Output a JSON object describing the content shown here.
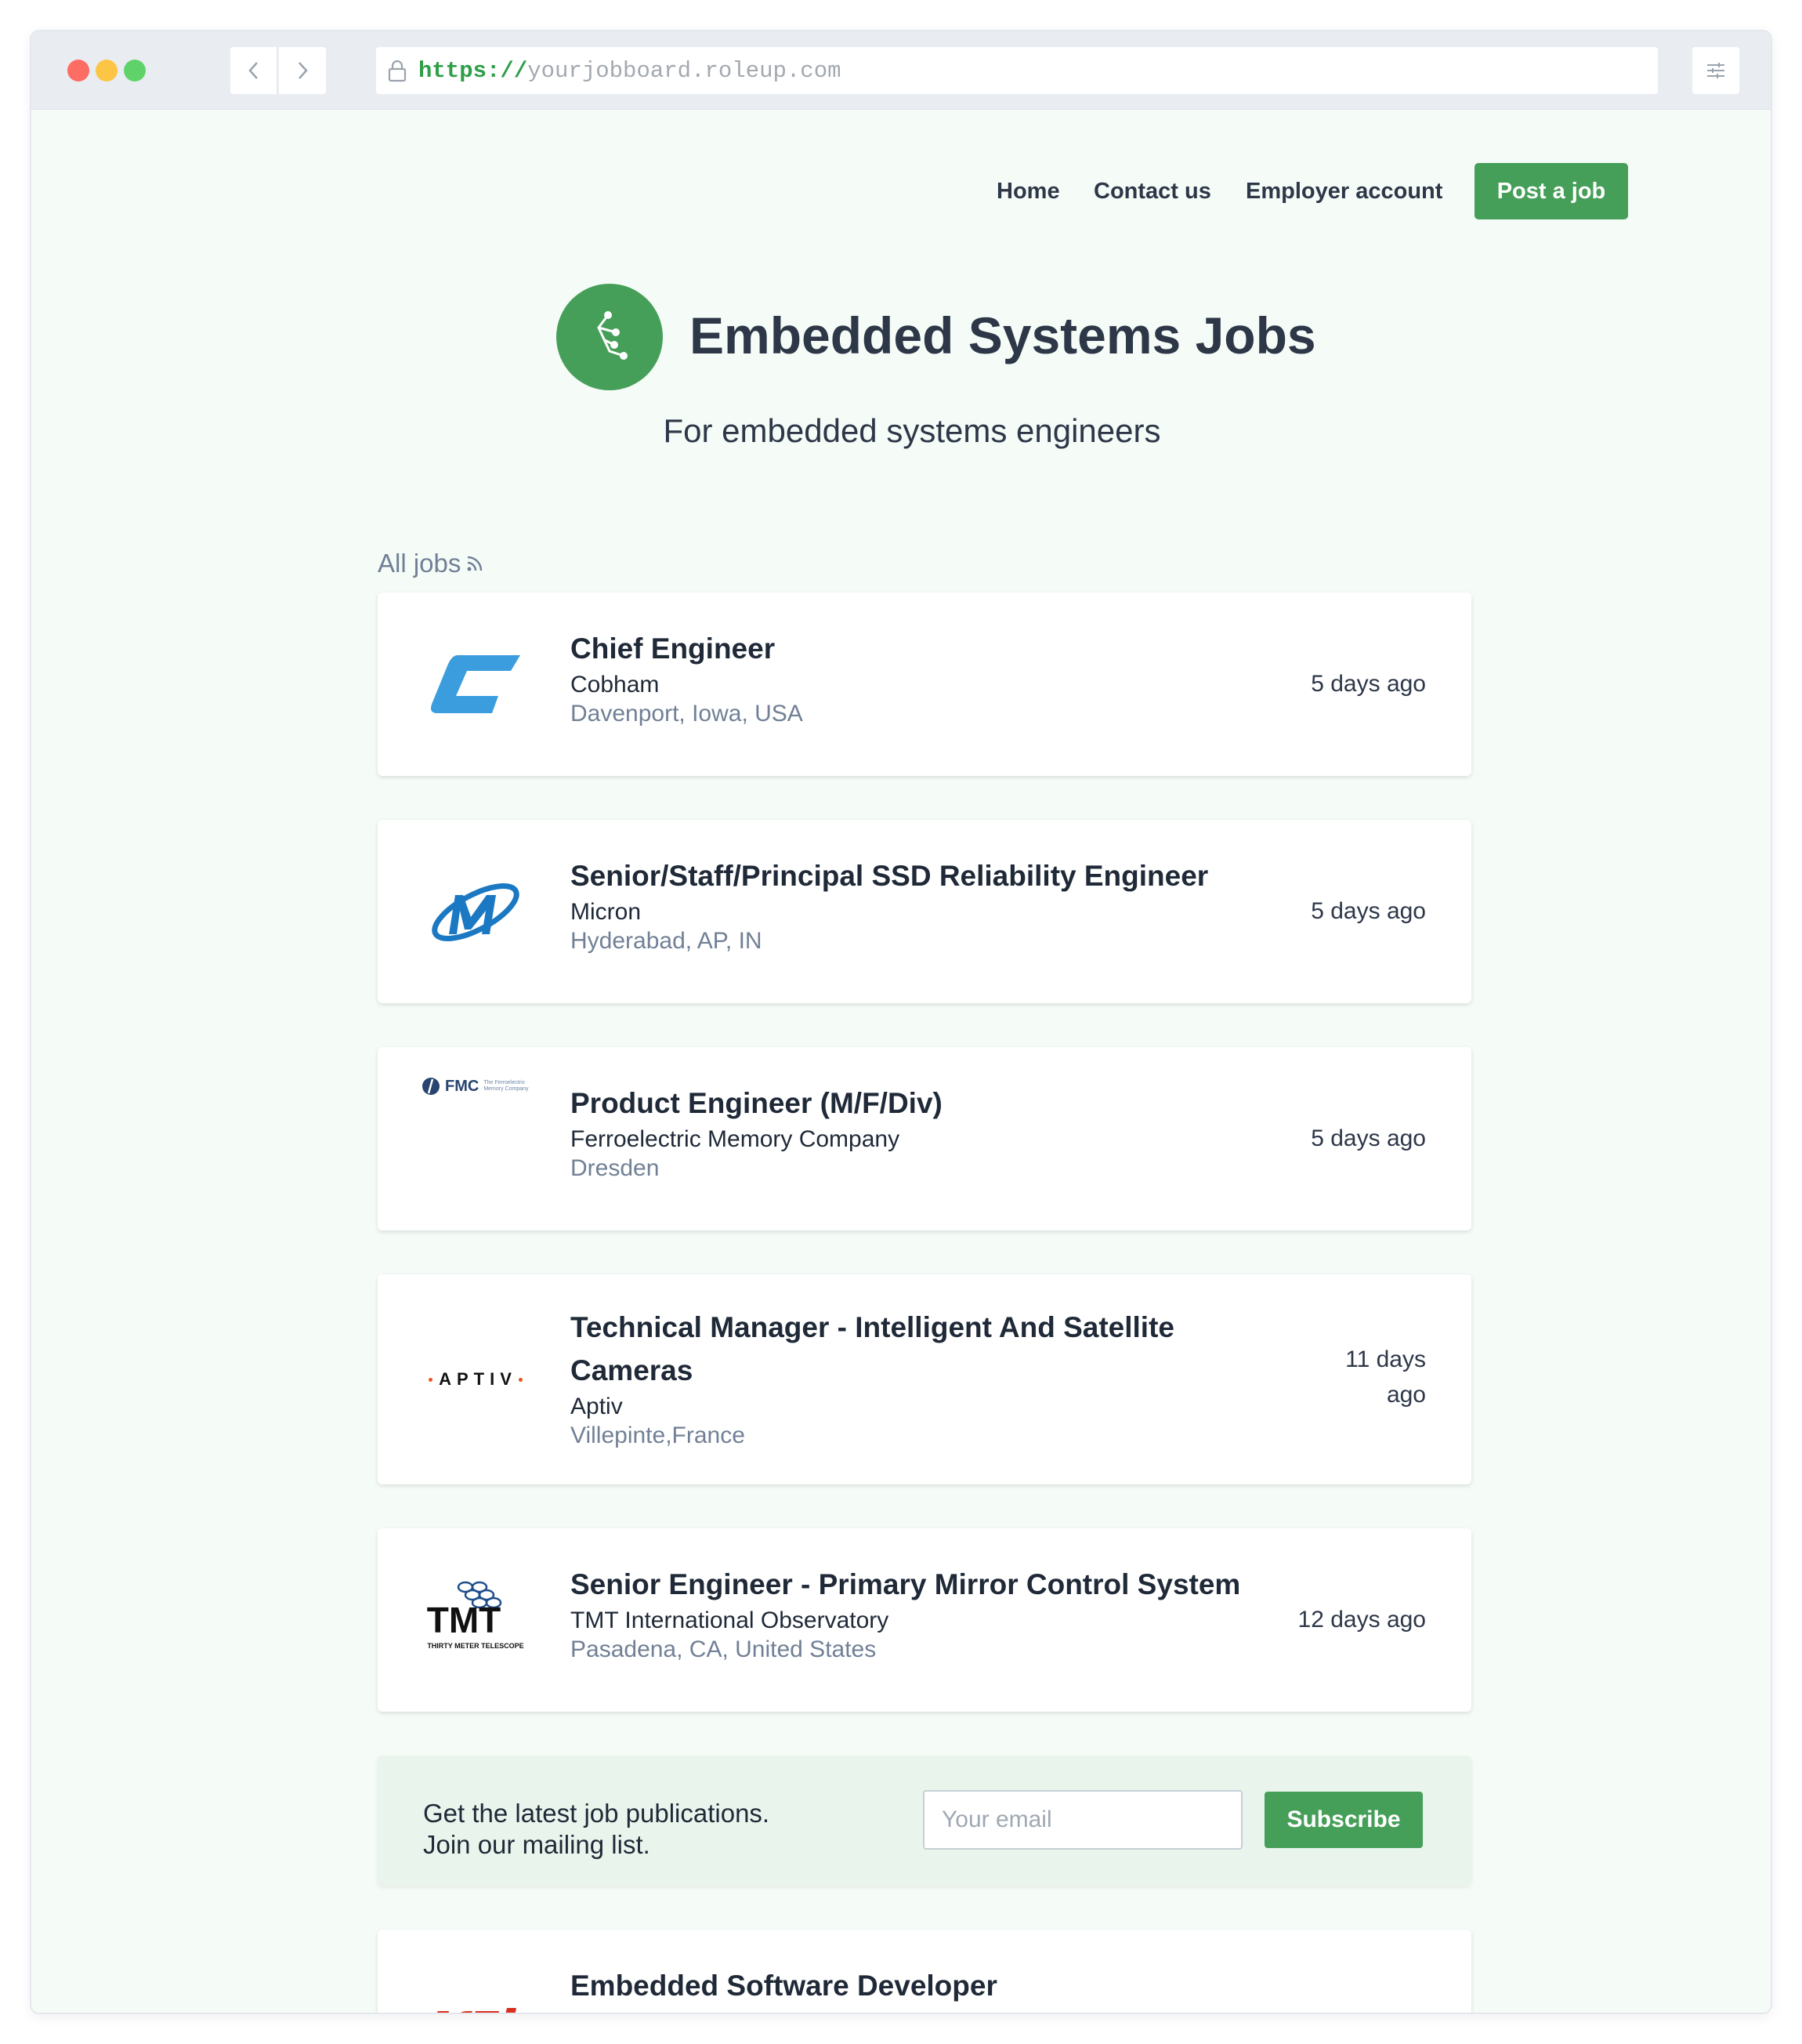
{
  "browser": {
    "url_scheme": "https://",
    "url_host": "yourjobboard.roleup.com"
  },
  "nav": {
    "home": "Home",
    "contact": "Contact us",
    "employer": "Employer account",
    "post_job": "Post a job"
  },
  "site": {
    "title": "Embedded Systems Jobs",
    "tagline": "For embedded systems engineers"
  },
  "all_jobs_label": "All jobs",
  "jobs": [
    {
      "title": "Chief Engineer",
      "company": "Cobham",
      "location": "Davenport, Iowa, USA",
      "posted": "5 days ago",
      "logo": "cobham-logo"
    },
    {
      "title": "Senior/Staff/Principal SSD Reliability Engineer",
      "company": "Micron",
      "location": "Hyderabad, AP, IN",
      "posted": "5 days ago",
      "logo": "micron-logo"
    },
    {
      "title": "Product Engineer (M/F/Div)",
      "company": "Ferroelectric Memory Company",
      "location": "Dresden",
      "posted": "5 days ago",
      "logo": "fmc-logo",
      "logo_text": "FMC",
      "logo_subtext": "The Ferroelectric Memory Company"
    },
    {
      "title": "Technical Manager - Intelligent And Satellite Cameras",
      "company": "Aptiv",
      "location": "Villepinte,France",
      "posted": "11 days ago",
      "logo": "aptiv-logo",
      "logo_text": "APTIV"
    },
    {
      "title": "Senior Engineer - Primary Mirror Control System",
      "company": "TMT International Observatory",
      "location": "Pasadena, CA, United States",
      "posted": "12 days ago",
      "logo": "tmt-logo",
      "logo_text": "TMT",
      "logo_subtext": "THIRTY METER TELESCOPE"
    },
    {
      "title": "Embedded Software Developer",
      "logo": "red-company-logo"
    }
  ],
  "subscribe": {
    "line1": "Get the latest job publications.",
    "line2": "Join our mailing list.",
    "email_placeholder": "Your email",
    "button": "Subscribe"
  },
  "colors": {
    "accent": "#469f59",
    "page_bg": "#f5fcf7",
    "subscribe_bg": "#e9f5ec"
  }
}
